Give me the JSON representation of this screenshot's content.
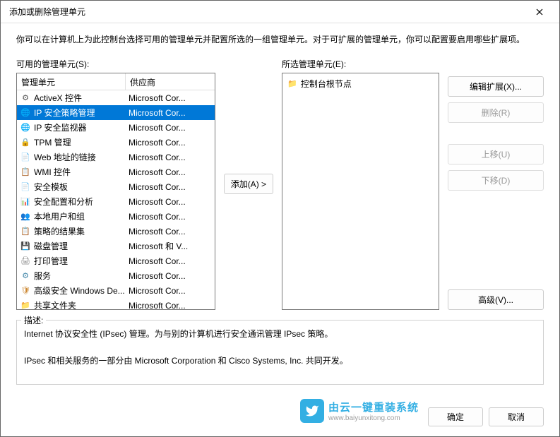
{
  "window": {
    "title": "添加或删除管理单元",
    "description": "你可以在计算机上为此控制台选择可用的管理单元并配置所选的一组管理单元。对于可扩展的管理单元，你可以配置要启用哪些扩展项。"
  },
  "labels": {
    "available": "可用的管理单元(S):",
    "selected": "所选管理单元(E):",
    "description_box": "描述:"
  },
  "headers": {
    "snapin": "管理单元",
    "vendor": "供应商"
  },
  "available_snapins": [
    {
      "name": "ActiveX 控件",
      "vendor": "Microsoft Cor...",
      "icon": "⚙",
      "color": "#555"
    },
    {
      "name": "IP 安全策略管理",
      "vendor": "Microsoft Cor...",
      "icon": "🌐",
      "color": "#0a7",
      "selected": true
    },
    {
      "name": "IP 安全监视器",
      "vendor": "Microsoft Cor...",
      "icon": "🌐",
      "color": "#0a7"
    },
    {
      "name": "TPM 管理",
      "vendor": "Microsoft Cor...",
      "icon": "🔒",
      "color": "#888"
    },
    {
      "name": "Web 地址的链接",
      "vendor": "Microsoft Cor...",
      "icon": "📄",
      "color": "#999"
    },
    {
      "name": "WMI 控件",
      "vendor": "Microsoft Cor...",
      "icon": "📋",
      "color": "#888"
    },
    {
      "name": "安全模板",
      "vendor": "Microsoft Cor...",
      "icon": "📄",
      "color": "#888"
    },
    {
      "name": "安全配置和分析",
      "vendor": "Microsoft Cor...",
      "icon": "📊",
      "color": "#888"
    },
    {
      "name": "本地用户和组",
      "vendor": "Microsoft Cor...",
      "icon": "👥",
      "color": "#36c"
    },
    {
      "name": "策略的结果集",
      "vendor": "Microsoft Cor...",
      "icon": "📋",
      "color": "#888"
    },
    {
      "name": "磁盘管理",
      "vendor": "Microsoft 和 V...",
      "icon": "💾",
      "color": "#888"
    },
    {
      "name": "打印管理",
      "vendor": "Microsoft Cor...",
      "icon": "🖨",
      "color": "#888"
    },
    {
      "name": "服务",
      "vendor": "Microsoft Cor...",
      "icon": "⚙",
      "color": "#48a"
    },
    {
      "name": "高级安全 Windows De...",
      "vendor": "Microsoft Cor...",
      "icon": "🛡",
      "color": "#c83"
    },
    {
      "name": "共享文件夹",
      "vendor": "Microsoft Cor...",
      "icon": "📁",
      "color": "#e8b050"
    }
  ],
  "selected_snapins": [
    {
      "name": "控制台根节点",
      "icon": "📁"
    }
  ],
  "buttons": {
    "add": "添加(A) >",
    "edit_ext": "编辑扩展(X)...",
    "remove": "删除(R)",
    "move_up": "上移(U)",
    "move_down": "下移(D)",
    "advanced": "高级(V)...",
    "ok": "确定",
    "cancel": "取消"
  },
  "description_text": {
    "line1": "Internet 协议安全性 (IPsec) 管理。为与别的计算机进行安全通讯管理 IPsec 策略。",
    "line2": "IPsec 和相关服务的一部分由 Microsoft Corporation 和 Cisco Systems, Inc. 共同开发。"
  },
  "watermark": {
    "main": "由云一键重装系统",
    "sub": "www.baiyunxitong.com"
  }
}
